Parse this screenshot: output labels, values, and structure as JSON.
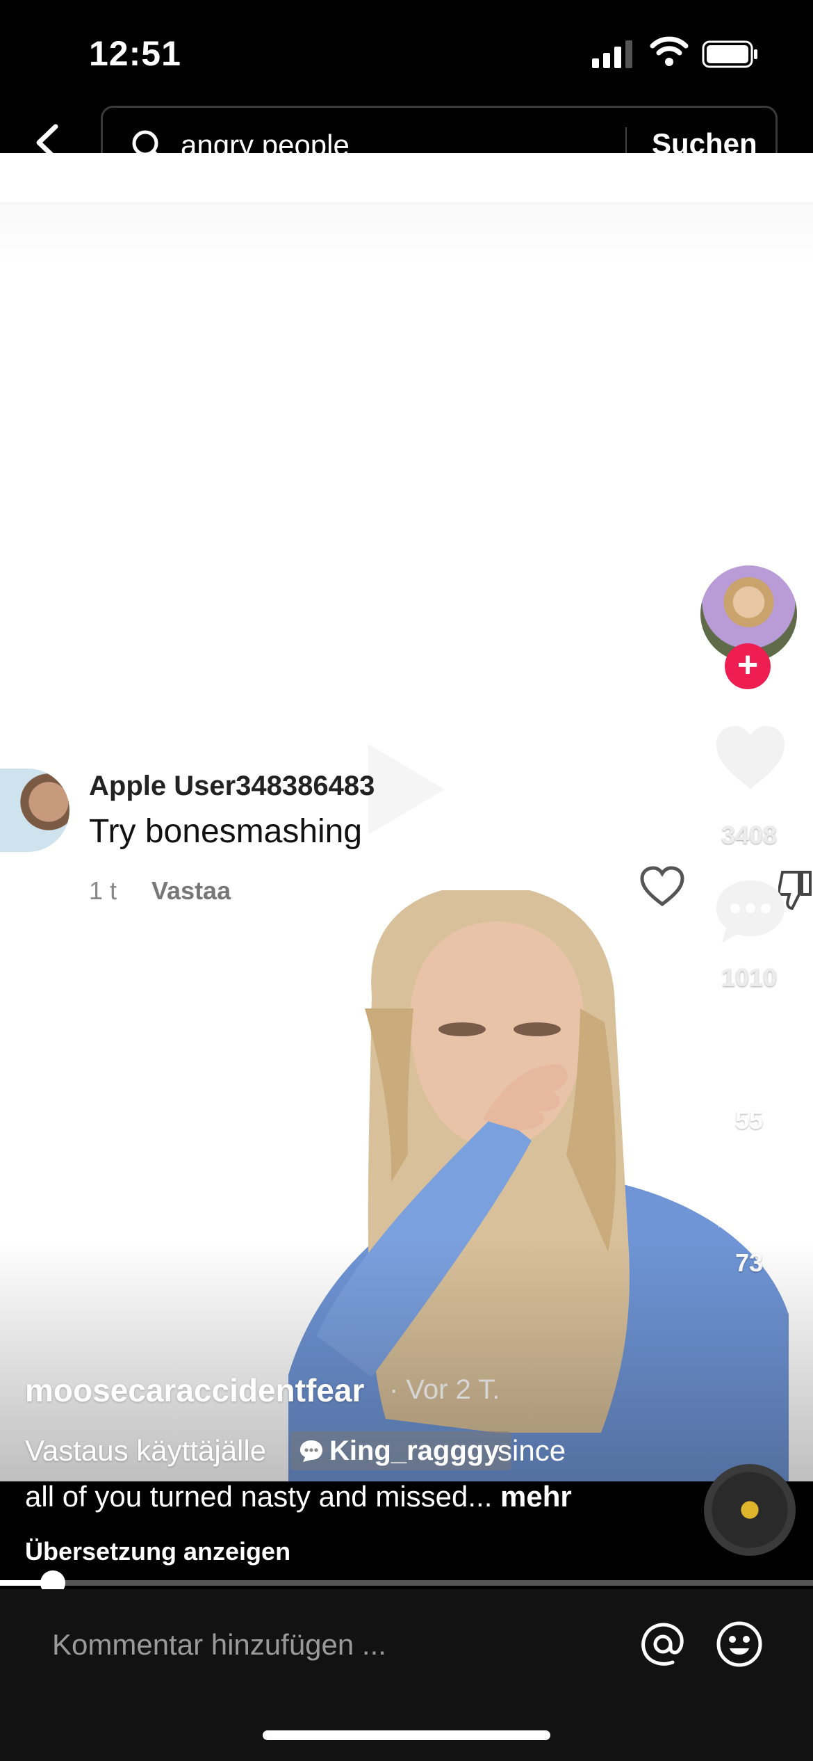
{
  "status_bar": {
    "time": "12:51"
  },
  "search": {
    "query": "angry people",
    "submit_label": "Suchen"
  },
  "overlay_comment": {
    "username": "Apple User348386483",
    "text": "Try bonesmashing",
    "time": "1 t",
    "reply_label": "Vastaa"
  },
  "rail": {
    "likes": "3408",
    "comments": "1010",
    "bookmarks": "55",
    "shares": "73"
  },
  "caption": {
    "author": "moosecaraccidentfear",
    "age": "· Vor 2 T.",
    "prefix": "Vastaus käyttäjälle",
    "reply_to": "King_ragggy",
    "after_chip": "since",
    "line2": "all of you turned nasty and missed...",
    "more_label": "mehr",
    "translate_label": "Übersetzung anzeigen"
  },
  "progress": {
    "fraction": 0.065
  },
  "comment_bar": {
    "placeholder": "Kommentar hinzufügen ..."
  },
  "icons": [
    "back-icon",
    "search-icon",
    "signal-icon",
    "wifi-icon",
    "battery-icon",
    "heart-icon",
    "dislike-icon",
    "comment-bubble-icon",
    "bookmark-icon",
    "share-arrow-icon",
    "music-disc-icon",
    "at-icon",
    "emoji-icon"
  ],
  "colors": {
    "follow": "#ee1d52",
    "disc_center": "#e0b52e"
  }
}
